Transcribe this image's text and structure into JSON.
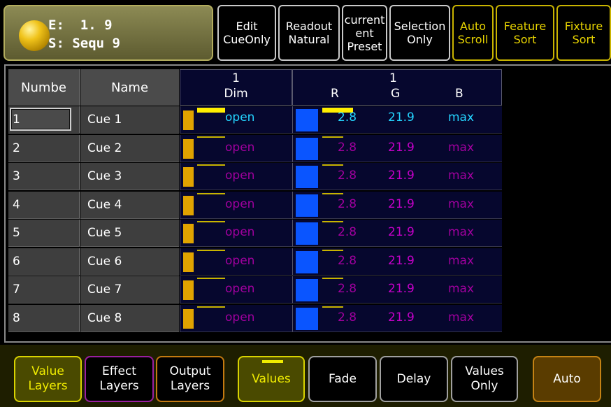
{
  "header": {
    "executor_line": "E:  1. 9",
    "sequence_line": "S: Sequ 9"
  },
  "toolbar": [
    {
      "lines": [
        "Edit",
        "CueOnly"
      ],
      "style": "white"
    },
    {
      "lines": [
        "Readout",
        "Natural"
      ],
      "style": "white"
    },
    {
      "lines": [
        "current",
        "ent",
        "Preset"
      ],
      "style": "white"
    },
    {
      "lines": [
        "Selection",
        "Only"
      ],
      "style": "white"
    },
    {
      "lines": [
        "Auto",
        "Scroll"
      ],
      "style": "yellow"
    },
    {
      "lines": [
        "Feature",
        "Sort"
      ],
      "style": "yellow"
    },
    {
      "lines": [
        "Fixture",
        "Sort"
      ],
      "style": "yellow"
    }
  ],
  "table": {
    "col_number": "Numbe",
    "col_name": "Name",
    "dim_fixture": "1",
    "dim_label": "Dim",
    "rgb_fixture": "1",
    "rgb_labels": [
      "R",
      "G",
      "B"
    ],
    "rows": [
      {
        "num": "1",
        "name": "Cue 1",
        "dim": "open",
        "r": "2.8",
        "g": "21.9",
        "b": "max"
      },
      {
        "num": "2",
        "name": "Cue 2",
        "dim": "open",
        "r": "2.8",
        "g": "21.9",
        "b": "max"
      },
      {
        "num": "3",
        "name": "Cue 3",
        "dim": "open",
        "r": "2.8",
        "g": "21.9",
        "b": "max"
      },
      {
        "num": "4",
        "name": "Cue 4",
        "dim": "open",
        "r": "2.8",
        "g": "21.9",
        "b": "max"
      },
      {
        "num": "5",
        "name": "Cue 5",
        "dim": "open",
        "r": "2.8",
        "g": "21.9",
        "b": "max"
      },
      {
        "num": "6",
        "name": "Cue 6",
        "dim": "open",
        "r": "2.8",
        "g": "21.9",
        "b": "max"
      },
      {
        "num": "7",
        "name": "Cue 7",
        "dim": "open",
        "r": "2.8",
        "g": "21.9",
        "b": "max"
      },
      {
        "num": "8",
        "name": "Cue 8",
        "dim": "open",
        "r": "2.8",
        "g": "21.9",
        "b": "max"
      }
    ]
  },
  "bottom": {
    "value_layers": [
      "Value",
      "Layers"
    ],
    "effect_layers": [
      "Effect",
      "Layers"
    ],
    "output_layers": [
      "Output",
      "Layers"
    ],
    "values": "Values",
    "fade": "Fade",
    "delay": "Delay",
    "values_only": [
      "Values",
      "Only"
    ],
    "auto": "Auto"
  },
  "colors": {
    "accent_yellow": "#e8d400",
    "value_cyan": "#24d4ff",
    "value_magenta": "#c400c8",
    "color_swatch": "#0a55ff",
    "dim_swatch": "#e0a300"
  }
}
